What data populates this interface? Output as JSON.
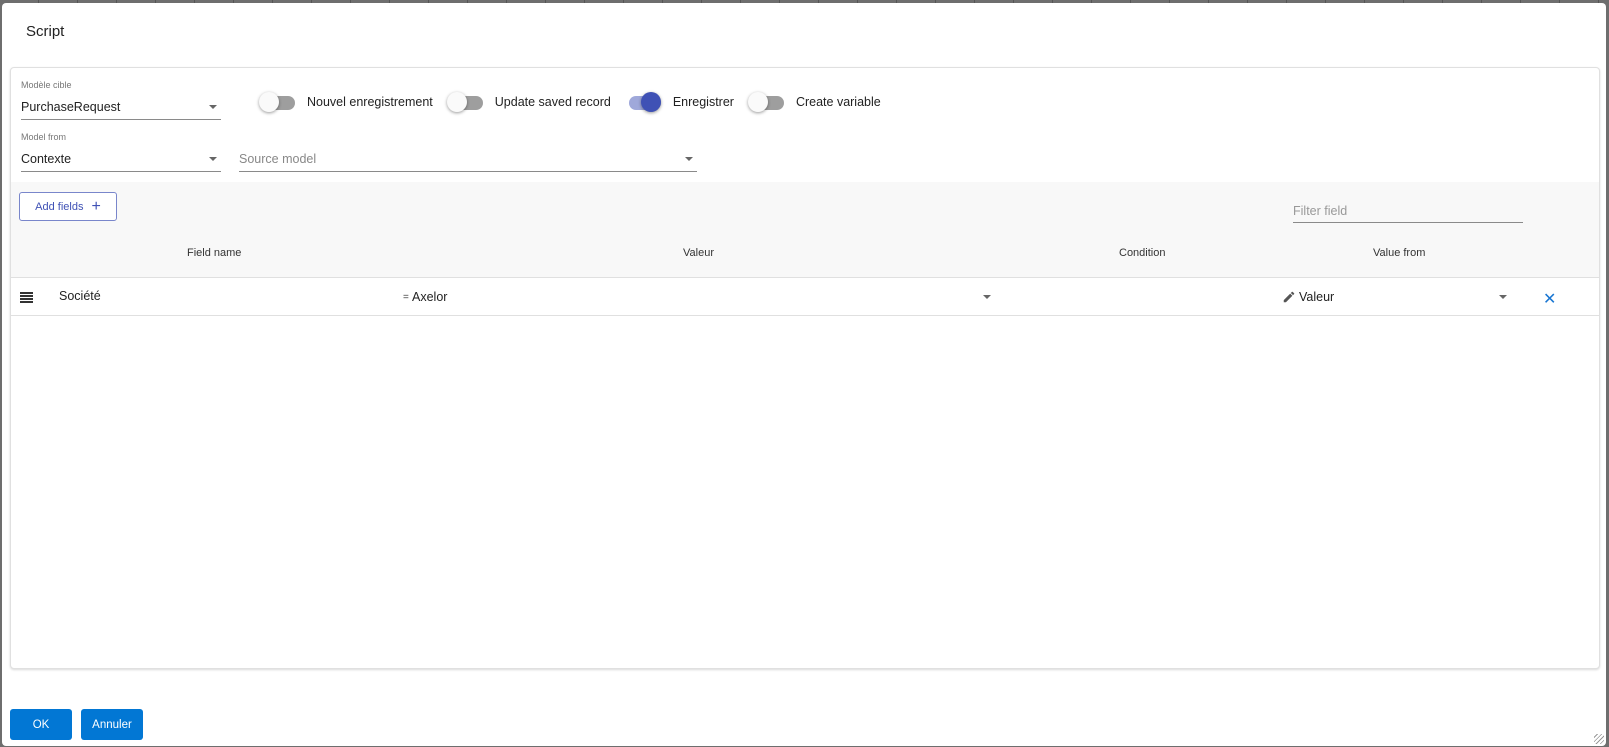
{
  "dialog": {
    "title": "Script"
  },
  "form": {
    "target_model": {
      "label": "Modèle cible",
      "value": "PurchaseRequest"
    },
    "toggles": [
      {
        "label": "Nouvel enregistrement",
        "on": false
      },
      {
        "label": "Update saved record",
        "on": false
      },
      {
        "label": "Enregistrer",
        "on": true
      },
      {
        "label": "Create variable",
        "on": false
      }
    ],
    "model_from": {
      "label": "Model from",
      "value": "Contexte"
    },
    "source_model": {
      "placeholder": "Source model",
      "value": ""
    }
  },
  "fields_toolbar": {
    "add_fields_label": "Add fields",
    "add_icon": "plus-icon",
    "filter_placeholder": "Filter field"
  },
  "table": {
    "columns": [
      "Field name",
      "Valeur",
      "Condition",
      "Value from"
    ],
    "rows": [
      {
        "field_name": "Société",
        "operator": "=",
        "value": "Axelor",
        "condition": "",
        "value_from": "Valeur"
      }
    ]
  },
  "icons": {
    "drag": "drag-handle-icon",
    "edit": "pencil-icon",
    "delete": "close-icon",
    "dropdown": "caret-down-icon"
  },
  "footer": {
    "ok_label": "OK",
    "cancel_label": "Annuler"
  },
  "colors": {
    "primary_button": "#0277d4",
    "toggle_on": "#3f51b5",
    "toggle_on_track": "#9fa8da",
    "delete_icon": "#1976d2"
  }
}
